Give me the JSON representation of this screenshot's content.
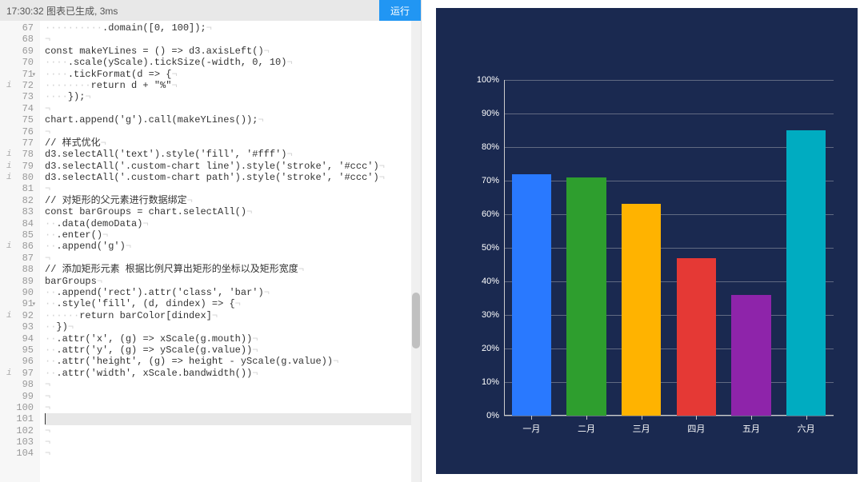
{
  "toolbar": {
    "status": "17:30:32  图表已生成, 3ms",
    "run_label": "运行"
  },
  "editor": {
    "start_line": 67,
    "lines": [
      {
        "n": 67,
        "info": false,
        "fold": false,
        "code": "          .domain([<num>0</num>, <num>100</num>]);"
      },
      {
        "n": 68,
        "info": false,
        "fold": false,
        "code": ""
      },
      {
        "n": 69,
        "info": false,
        "fold": false,
        "code": "<kw>const</kw> makeYLines = () => d3.axisLeft()"
      },
      {
        "n": 70,
        "info": false,
        "fold": false,
        "code": "    .scale(yScale).tickSize(-width, <num>0</num>, <num>10</num>)"
      },
      {
        "n": 71,
        "info": false,
        "fold": true,
        "code": "    .tickFormat(d => {"
      },
      {
        "n": 72,
        "info": true,
        "fold": false,
        "code": "        <kw>return</kw> d + <str>\"%\"</str>"
      },
      {
        "n": 73,
        "info": false,
        "fold": false,
        "code": "    });"
      },
      {
        "n": 74,
        "info": false,
        "fold": false,
        "code": ""
      },
      {
        "n": 75,
        "info": false,
        "fold": false,
        "code": "chart.append(<str>'g'</str>).call(makeYLines());"
      },
      {
        "n": 76,
        "info": false,
        "fold": false,
        "code": ""
      },
      {
        "n": 77,
        "info": false,
        "fold": false,
        "code": "<cmt>// 样式优化</cmt>"
      },
      {
        "n": 78,
        "info": true,
        "fold": false,
        "code": "d3.selectAll(<str>'text'</str>).style(<str>'fill'</str>, <str>'#fff'</str>)"
      },
      {
        "n": 79,
        "info": true,
        "fold": false,
        "code": "d3.selectAll(<str>'.custom-chart line'</str>).style(<str>'stroke'</str>, <str>'#ccc'</str>)"
      },
      {
        "n": 80,
        "info": true,
        "fold": false,
        "code": "d3.selectAll(<str>'.custom-chart path'</str>).style(<str>'stroke'</str>, <str>'#ccc'</str>)"
      },
      {
        "n": 81,
        "info": false,
        "fold": false,
        "code": ""
      },
      {
        "n": 82,
        "info": false,
        "fold": false,
        "code": "<cmt>// 对矩形的父元素进行数据绑定</cmt>"
      },
      {
        "n": 83,
        "info": false,
        "fold": false,
        "code": "<kw>const</kw> barGroups = chart.selectAll()"
      },
      {
        "n": 84,
        "info": false,
        "fold": false,
        "code": "  .data(demoData)"
      },
      {
        "n": 85,
        "info": false,
        "fold": false,
        "code": "  .enter()"
      },
      {
        "n": 86,
        "info": true,
        "fold": false,
        "code": "  .append(<str>'g'</str>)"
      },
      {
        "n": 87,
        "info": false,
        "fold": false,
        "code": ""
      },
      {
        "n": 88,
        "info": false,
        "fold": false,
        "code": "<cmt>// 添加矩形元素 根据比例尺算出矩形的坐标以及矩形宽度</cmt>"
      },
      {
        "n": 89,
        "info": false,
        "fold": false,
        "code": "barGroups"
      },
      {
        "n": 90,
        "info": false,
        "fold": false,
        "code": "  .append(<str>'rect'</str>).attr(<str>'class'</str>, <str>'bar'</str>)"
      },
      {
        "n": 91,
        "info": false,
        "fold": true,
        "code": "  .style(<str>'fill'</str>, (d, dindex) => {"
      },
      {
        "n": 92,
        "info": true,
        "fold": false,
        "code": "      <kw>return</kw> barColor[dindex]"
      },
      {
        "n": 93,
        "info": false,
        "fold": false,
        "code": "  })"
      },
      {
        "n": 94,
        "info": false,
        "fold": false,
        "code": "  .attr(<str>'x'</str>, (g) => xScale(g.mouth))"
      },
      {
        "n": 95,
        "info": false,
        "fold": false,
        "code": "  .attr(<str>'y'</str>, (g) => yScale(g.value))"
      },
      {
        "n": 96,
        "info": false,
        "fold": false,
        "code": "  .attr(<str>'height'</str>, (g) => height - yScale(g.value))"
      },
      {
        "n": 97,
        "info": true,
        "fold": false,
        "code": "  .attr(<str>'width'</str>, xScale.bandwidth())"
      },
      {
        "n": 98,
        "info": false,
        "fold": false,
        "code": ""
      },
      {
        "n": 99,
        "info": false,
        "fold": false,
        "code": ""
      },
      {
        "n": 100,
        "info": false,
        "fold": false,
        "code": ""
      },
      {
        "n": 101,
        "info": false,
        "fold": false,
        "code": "",
        "hl": true
      },
      {
        "n": 102,
        "info": false,
        "fold": false,
        "code": ""
      },
      {
        "n": 103,
        "info": false,
        "fold": false,
        "code": ""
      },
      {
        "n": 104,
        "info": false,
        "fold": false,
        "code": ""
      }
    ]
  },
  "chart_data": {
    "type": "bar",
    "categories": [
      "一月",
      "二月",
      "三月",
      "四月",
      "五月",
      "六月"
    ],
    "values": [
      72,
      71,
      63,
      47,
      36,
      85
    ],
    "colors": [
      "#2979ff",
      "#2e9e2e",
      "#ffb300",
      "#e53935",
      "#8e24aa",
      "#00acc1"
    ],
    "ylim": [
      0,
      100
    ],
    "y_ticks": [
      0,
      10,
      20,
      30,
      40,
      50,
      60,
      70,
      80,
      90,
      100
    ],
    "background": "#1a2950"
  }
}
